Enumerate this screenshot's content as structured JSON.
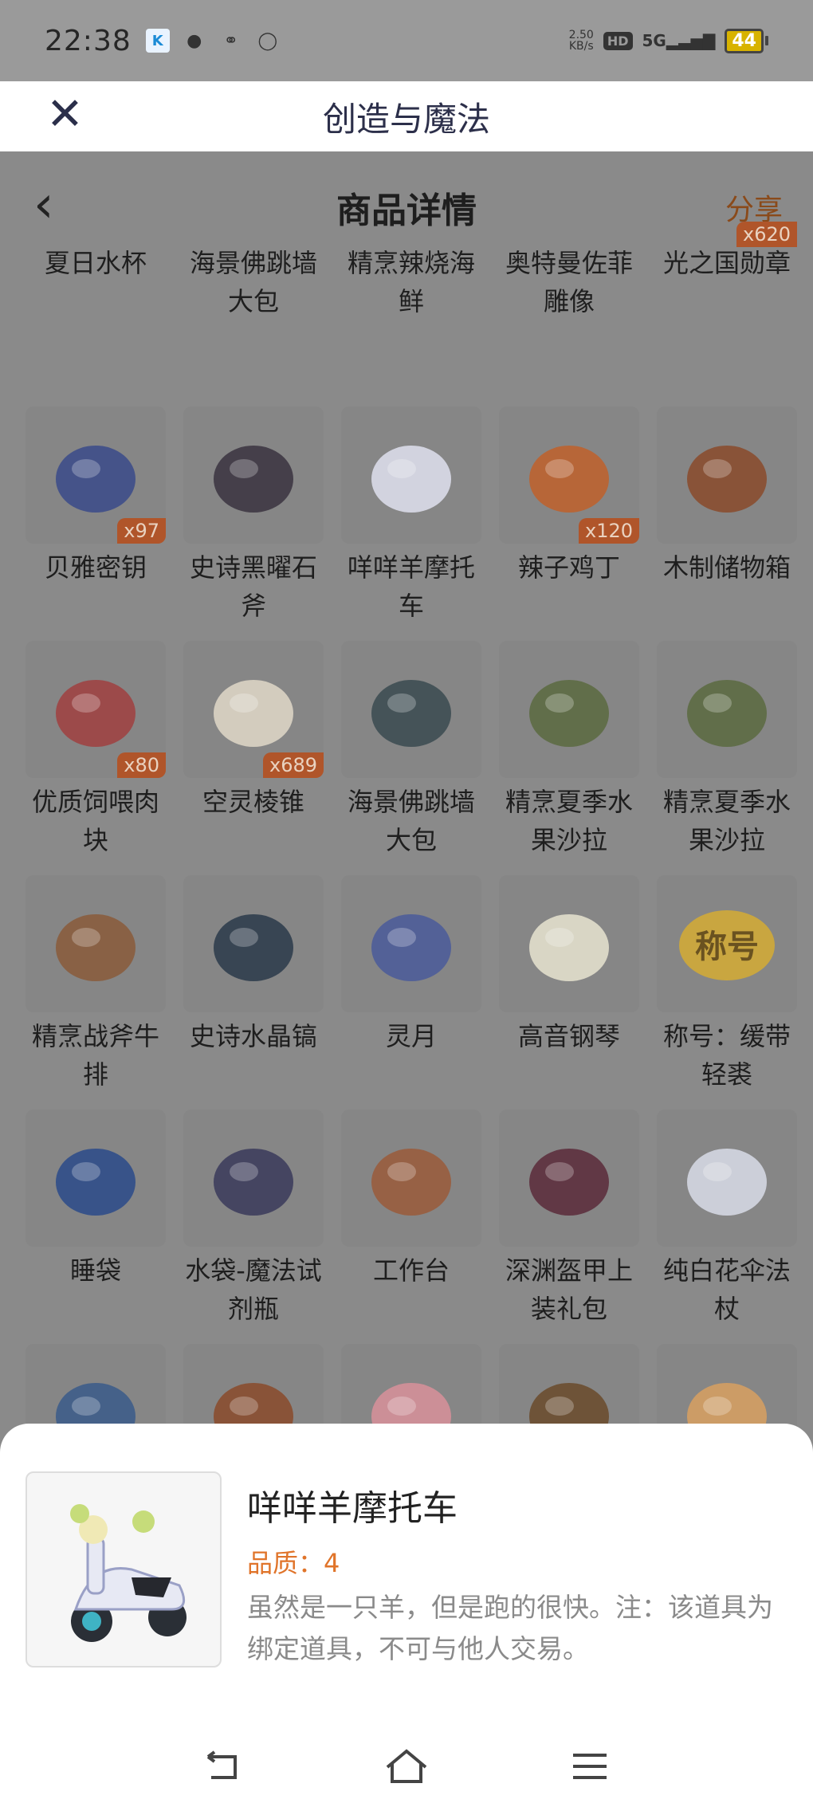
{
  "status_bar": {
    "time": "22:38",
    "speed": "2.50",
    "speed_unit": "KB/s",
    "hd": "HD",
    "network": "5G",
    "battery": "44",
    "icons": [
      "k-icon",
      "message-icon",
      "link-icon",
      "cloud-icon"
    ]
  },
  "web_header": {
    "close_icon": "close-icon",
    "title": "创造与魔法"
  },
  "nav": {
    "back_icon": "back-icon",
    "title": "商品详情",
    "share_label": "分享"
  },
  "top_labels": [
    "夏日水杯",
    "海景佛跳墙大包",
    "精烹辣烧海鲜",
    "奥特曼佐菲雕像",
    "光之国勋章"
  ],
  "top_qty": "x620",
  "items": [
    {
      "label": "贝雅密钥",
      "qty": "x97",
      "icon": "key-card-icon"
    },
    {
      "label": "史诗黑曜石斧",
      "qty": "",
      "icon": "axe-icon"
    },
    {
      "label": "咩咩羊摩托车",
      "qty": "",
      "icon": "scooter-icon"
    },
    {
      "label": "辣子鸡丁",
      "qty": "x120",
      "icon": "dish-icon"
    },
    {
      "label": "木制储物箱",
      "qty": "",
      "icon": "chest-icon"
    },
    {
      "label": "优质饲喂肉块",
      "qty": "x80",
      "icon": "meat-icon"
    },
    {
      "label": "空灵棱锥",
      "qty": "x689",
      "icon": "crystal-icon"
    },
    {
      "label": "海景佛跳墙大包",
      "qty": "",
      "icon": "bowl-icon"
    },
    {
      "label": "精烹夏季水果沙拉",
      "qty": "",
      "icon": "salad-icon"
    },
    {
      "label": "精烹夏季水果沙拉",
      "qty": "",
      "icon": "salad-icon"
    },
    {
      "label": "精烹战斧牛排",
      "qty": "",
      "icon": "steak-icon"
    },
    {
      "label": "史诗水晶镐",
      "qty": "",
      "icon": "pickaxe-icon"
    },
    {
      "label": "灵月",
      "qty": "",
      "icon": "moon-icon"
    },
    {
      "label": "高音钢琴",
      "qty": "",
      "icon": "piano-icon"
    },
    {
      "label": "称号：缓带轻裘",
      "qty": "",
      "icon": "title-badge-icon"
    },
    {
      "label": "睡袋",
      "qty": "",
      "icon": "sleeping-bag-icon"
    },
    {
      "label": "水袋-魔法试剂瓶",
      "qty": "",
      "icon": "flask-icon"
    },
    {
      "label": "工作台",
      "qty": "",
      "icon": "workbench-icon"
    },
    {
      "label": "深渊盔甲上装礼包",
      "qty": "",
      "icon": "armor-icon"
    },
    {
      "label": "纯白花伞法杖",
      "qty": "",
      "icon": "umbrella-icon"
    },
    {
      "label": "",
      "qty": "",
      "icon": "dragon-icon"
    },
    {
      "label": "",
      "qty": "",
      "icon": "soup-icon"
    },
    {
      "label": "",
      "qty": "",
      "icon": "bottle-icon"
    },
    {
      "label": "",
      "qty": "",
      "icon": "coconut-icon"
    },
    {
      "label": "",
      "qty": "",
      "icon": "fish-dish-icon"
    }
  ],
  "badge_text": "称号",
  "sheet": {
    "title": "咩咩羊摩托车",
    "quality": "品质：4",
    "description": "虽然是一只羊，但是跑的很快。注：该道具为绑定道具，不可与他人交易。"
  },
  "system_nav": [
    "back-icon",
    "home-icon",
    "menu-icon"
  ]
}
